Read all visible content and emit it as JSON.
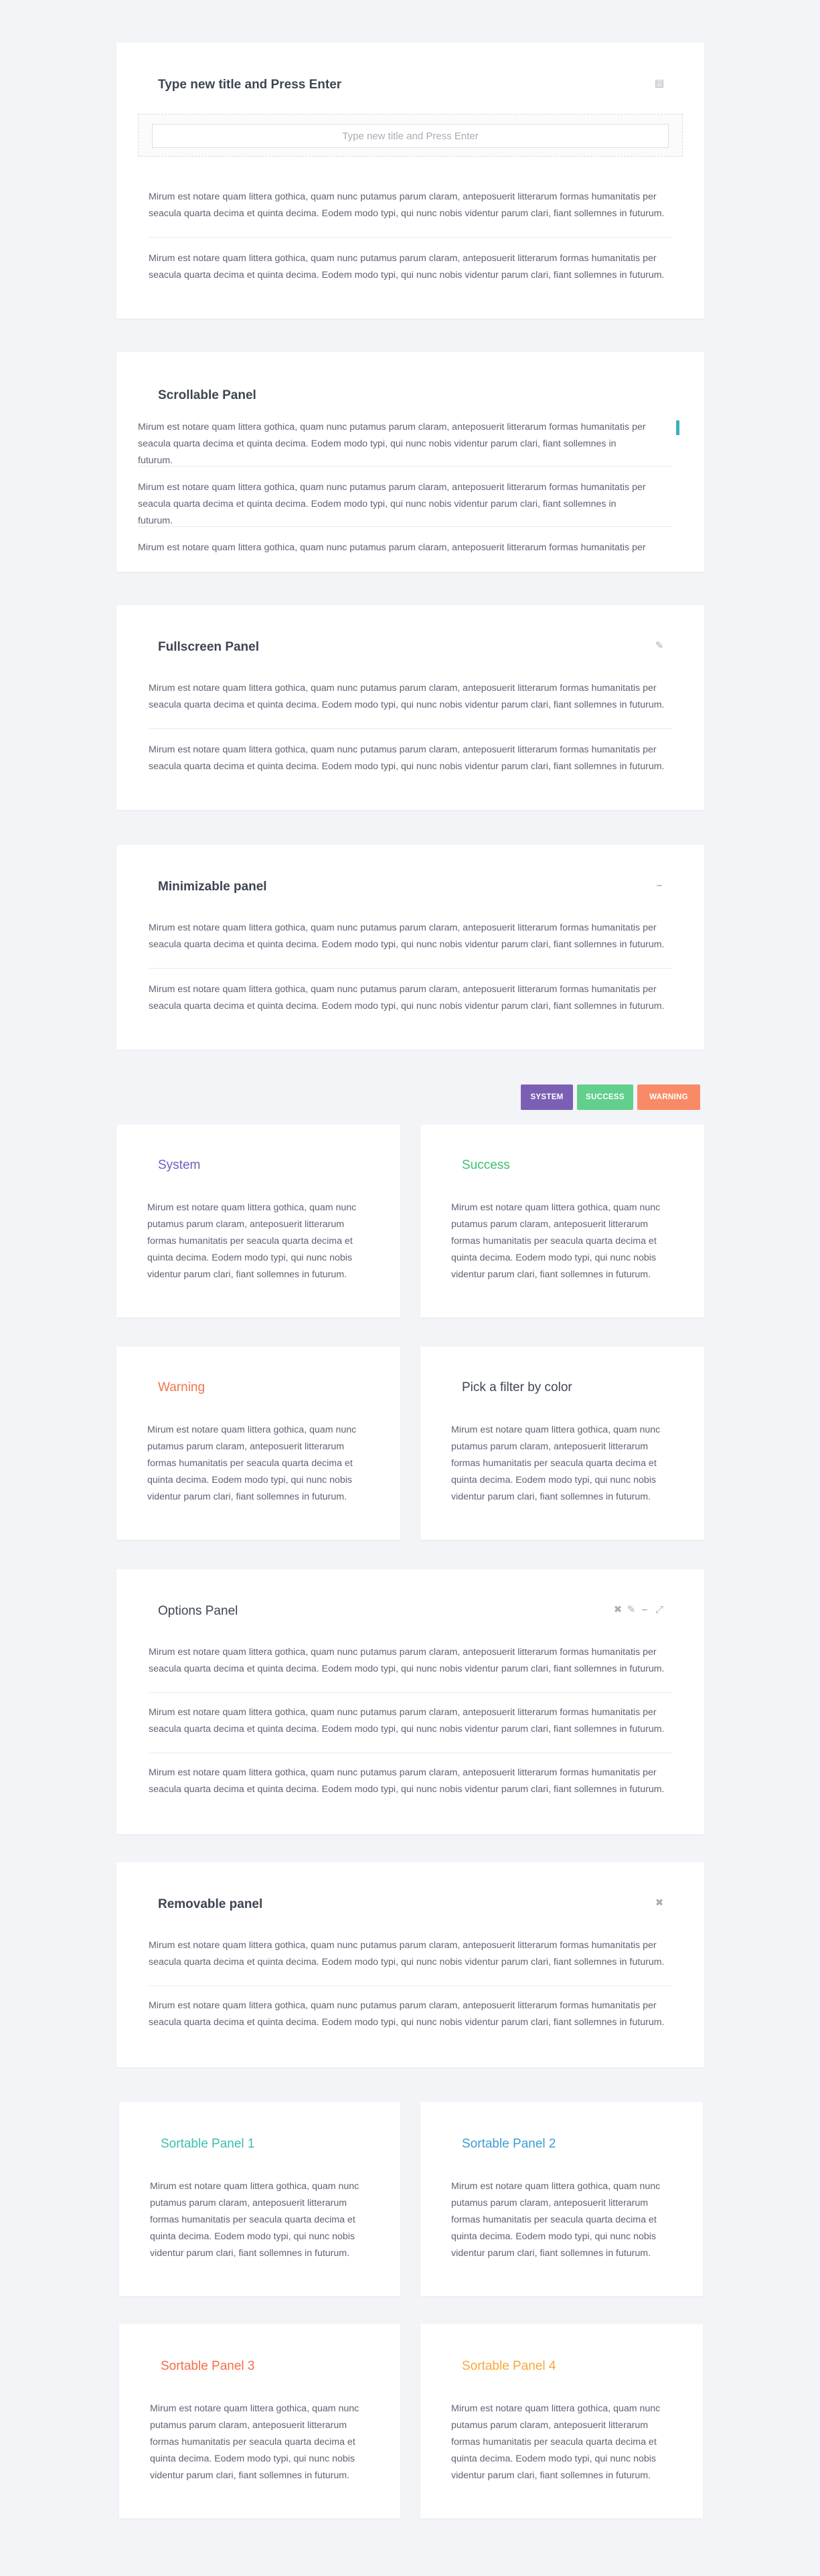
{
  "body_text": "Mirum est notare quam littera gothica, quam nunc putamus parum claram, anteposuerit litterarum formas humanitatis per seacula quarta decima et quinta decima. Eodem modo typi, qui nunc nobis videntur parum clari, fiant sollemnes in futurum.",
  "title_panel": {
    "title": "Type new title and Press Enter",
    "input_placeholder": "Type new title and Press Enter",
    "icon": "save-icon"
  },
  "scrollable_panel": {
    "title": "Scrollable Panel"
  },
  "fullscreen_panel": {
    "title": "Fullscreen Panel",
    "icon": "pencil-icon"
  },
  "minimizable_panel": {
    "title": "Minimizable panel",
    "icon": "minus-icon"
  },
  "filter_buttons": [
    {
      "label": "SYSTEM",
      "color": "#7b5fb5"
    },
    {
      "label": "SUCCESS",
      "color": "#62cf8c"
    },
    {
      "label": "WARNING",
      "color": "#f98a67"
    }
  ],
  "color_panels": {
    "system": {
      "title": "System",
      "color": "#6a5fbd"
    },
    "success": {
      "title": "Success",
      "color": "#3fbf6e"
    },
    "warning": {
      "title": "Warning",
      "color": "#f0744d"
    },
    "filter": {
      "title": "Pick a filter by color",
      "color": "#3e4552"
    }
  },
  "options_panel": {
    "title": "Options Panel",
    "icons": [
      "close-icon",
      "pencil-icon",
      "minus-icon",
      "expand-icon"
    ]
  },
  "removable_panel": {
    "title": "Removable panel",
    "icon": "close-icon"
  },
  "sortable_panels": [
    {
      "title": "Sortable Panel 1",
      "color": "#3cbfab"
    },
    {
      "title": "Sortable Panel 2",
      "color": "#3b9ed3"
    },
    {
      "title": "Sortable Panel 3",
      "color": "#f66c47"
    },
    {
      "title": "Sortable Panel 4",
      "color": "#f7a83a"
    }
  ]
}
